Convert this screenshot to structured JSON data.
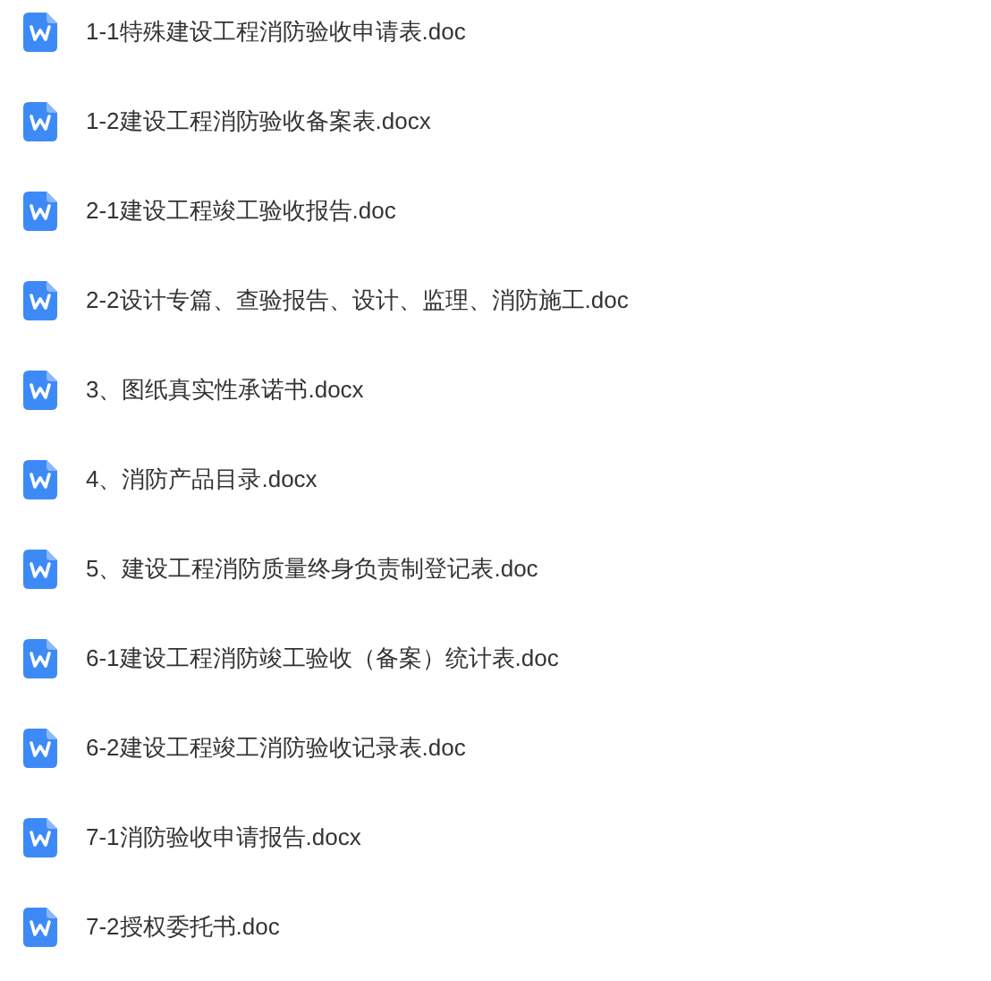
{
  "files": [
    {
      "name": "1-1特殊建设工程消防验收申请表.doc"
    },
    {
      "name": "1-2建设工程消防验收备案表.docx"
    },
    {
      "name": "2-1建设工程竣工验收报告.doc"
    },
    {
      "name": "2-2设计专篇、查验报告、设计、监理、消防施工.doc"
    },
    {
      "name": "3、图纸真实性承诺书.docx"
    },
    {
      "name": "4、消防产品目录.docx"
    },
    {
      "name": "5、建设工程消防质量终身负责制登记表.doc"
    },
    {
      "name": "6-1建设工程消防竣工验收（备案）统计表.doc"
    },
    {
      "name": "6-2建设工程竣工消防验收记录表.doc"
    },
    {
      "name": "7-1消防验收申请报告.docx"
    },
    {
      "name": "7-2授权委托书.doc"
    }
  ]
}
